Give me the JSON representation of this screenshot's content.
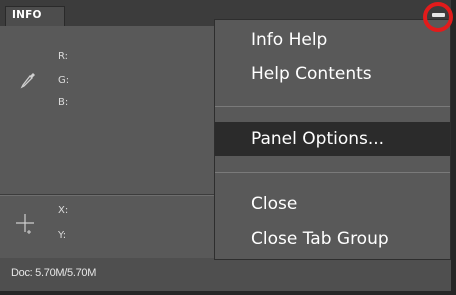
{
  "panel": {
    "tab_label": "INFO",
    "color_labels": [
      "R:",
      "G:",
      "B:"
    ],
    "coord_labels": [
      "X:",
      "Y:"
    ],
    "status": "Doc: 5.70M/5.70M",
    "icons": {
      "eyedropper": "eyedropper-icon",
      "crosshair": "crosshair-icon",
      "panel_menu": "panel-menu-icon"
    }
  },
  "menu": {
    "items": [
      {
        "label": "Info Help"
      },
      {
        "label": "Help Contents"
      },
      {
        "label": "Panel Options...",
        "selected": true
      },
      {
        "label": "Close"
      },
      {
        "label": "Close Tab Group"
      }
    ]
  },
  "colors": {
    "panel_bg": "#595959",
    "selected_item": "#2b2b2b",
    "highlight_ring": "#e21b1b"
  }
}
